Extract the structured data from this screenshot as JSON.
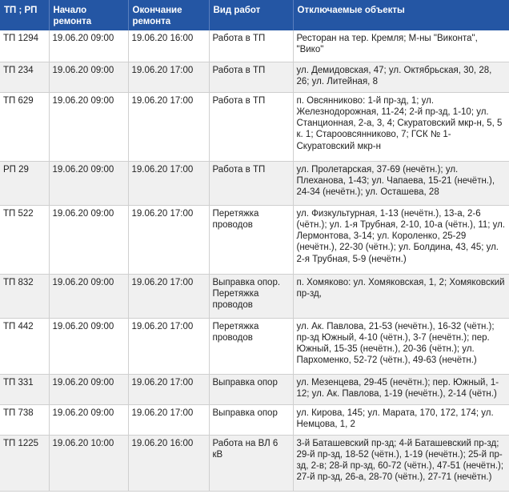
{
  "headers": {
    "tp_rp": "ТП ; РП",
    "start": "Начало ремонта",
    "end": "Окончание ремонта",
    "work_type": "Вид работ",
    "objects": "Отключаемые объекты"
  },
  "rows": [
    {
      "tp": "ТП 1294",
      "start": "19.06.20 09:00",
      "end": "19.06.20 16:00",
      "work": "Работа в ТП",
      "objects": "Ресторан на тер. Кремля; М-ны \"Виконта\", \"Вико\""
    },
    {
      "tp": "ТП 234",
      "start": "19.06.20 09:00",
      "end": "19.06.20 17:00",
      "work": "Работа в ТП",
      "objects": "ул. Демидовская, 47; ул. Октябрьская, 30, 28, 26; ул. Литейная, 8"
    },
    {
      "tp": "ТП 629",
      "start": "19.06.20 09:00",
      "end": "19.06.20 17:00",
      "work": "Работа в ТП",
      "objects": "п. Овсянниково: 1-й пр-зд, 1; ул. Железнодорожная, 11-24; 2-й пр-зд, 1-10; ул. Станционная, 2-а, 3, 4; Скуратовский мкр-н, 5, 5 к. 1; Староовсянниково, 7; ГСК № 1-Скуратовский мкр-н"
    },
    {
      "tp": "РП 29",
      "start": "19.06.20 09:00",
      "end": "19.06.20 17:00",
      "work": "Работа в ТП",
      "objects": "ул. Пролетарская, 37-69 (нечётн.); ул. Плеханова, 1-43; ул. Чапаева, 15-21 (нечётн.), 24-34 (нечётн.); ул. Осташева, 28"
    },
    {
      "tp": "ТП 522",
      "start": "19.06.20 09:00",
      "end": "19.06.20 17:00",
      "work": "Перетяжка проводов",
      "objects": "ул. Физкультурная, 1-13 (нечётн.), 13-а, 2-6 (чётн.); ул. 1-я Трубная, 2-10, 10-а (чётн.), 11; ул. Лермонтова, 3-14; ул. Короленко, 25-29 (нечётн.), 22-30 (чётн.); ул. Болдина, 43, 45; ул. 2-я Трубная, 5-9 (нечётн.)"
    },
    {
      "tp": "ТП 832",
      "start": "19.06.20 09:00",
      "end": "19.06.20 17:00",
      "work": "Выправка опор. Перетяжка проводов",
      "objects": "п. Хомяково: ул. Хомяковская, 1, 2; Хомяковский пр-зд,"
    },
    {
      "tp": "ТП 442",
      "start": "19.06.20 09:00",
      "end": "19.06.20 17:00",
      "work": "Перетяжка проводов",
      "objects": "ул. Ак. Павлова, 21-53 (нечётн.), 16-32 (чётн.); пр-зд Южный, 4-10 (чётн.), 3-7 (нечётн.); пер. Южный, 15-35 (нечётн.), 20-36 (чётн.); ул. Пархоменко, 52-72 (чётн.), 49-63 (нечётн.)"
    },
    {
      "tp": "ТП 331",
      "start": "19.06.20 09:00",
      "end": "19.06.20 17:00",
      "work": "Выправка опор",
      "objects": "ул. Мезенцева, 29-45 (нечётн.); пер. Южный, 1-12; ул. Ак. Павлова, 1-19 (нечётн.), 2-14 (чётн.)"
    },
    {
      "tp": "ТП 738",
      "start": "19.06.20 09:00",
      "end": "19.06.20 17:00",
      "work": "Выправка опор",
      "objects": "ул. Кирова, 145; ул. Марата, 170, 172, 174; ул. Немцова, 1, 2"
    },
    {
      "tp": "ТП 1225",
      "start": "19.06.20 10:00",
      "end": "19.06.20 16:00",
      "work": "Работа на ВЛ 6 кВ",
      "objects": "3-й Баташевский пр-зд; 4-й Баташевский пр-зд; 29-й пр-зд, 18-52 (чётн.), 1-19 (нечётн.); 25-й пр-зд, 2-в; 28-й пр-зд, 60-72 (чётн.), 47-51 (нечётн.); 27-й пр-зд, 26-а, 28-70 (чётн.), 27-71 (нечётн.)"
    }
  ]
}
